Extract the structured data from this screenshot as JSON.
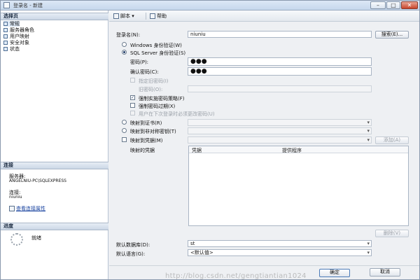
{
  "window": {
    "title": "登录名 - 新建",
    "controls": [
      "–",
      "□",
      "✕"
    ]
  },
  "left_panel": {
    "select_page_header": "选择页",
    "pages": [
      {
        "label": "常规"
      },
      {
        "label": "服务器角色"
      },
      {
        "label": "用户映射"
      },
      {
        "label": "安全对象"
      },
      {
        "label": "状态"
      }
    ],
    "connection_header": "连接",
    "server_label": "服务器:",
    "server_value": "ANGELNIU-PC\\SQLEXPRESS",
    "connection_label": "连接:",
    "connection_value": "niuniu",
    "view_connection_link": "查看连接属性",
    "progress_header": "进度",
    "progress_status": "就绪"
  },
  "toolbar": {
    "script_label": "脚本",
    "help_label": "帮助"
  },
  "form": {
    "login_name_label": "登录名(N):",
    "login_name_value": "niuniu",
    "search_button": "搜索(E)...",
    "windows_auth_label": "Windows 身份验证(W)",
    "sql_auth_label": "SQL Server 身份验证(S)",
    "password_label": "密码(P):",
    "password_value": "●●●",
    "confirm_password_label": "确认密码(C):",
    "confirm_password_value": "●●●",
    "specify_old_password_label": "指定旧密码(I)",
    "old_password_label": "旧密码(O):",
    "enforce_policy_label": "强制实施密码策略(F)",
    "enforce_expiration_label": "强制密码过期(X)",
    "must_change_label": "用户在下次登录时必须更改密码(U)",
    "map_certificate_label": "映射到证书(R)",
    "map_asymmetric_key_label": "映射到非对称密钥(T)",
    "map_credential_label": "映射到凭据(M)",
    "add_button": "添加(A)",
    "mapped_credentials_label": "映射的凭据",
    "credentials_columns": [
      "凭据",
      "提供程序"
    ],
    "remove_button": "删除(V)",
    "default_database_label": "默认数据库(D):",
    "default_database_value": "st",
    "default_language_label": "默认语言(G):",
    "default_language_value": "<默认值>"
  },
  "footer": {
    "watermark": "http://blog.csdn.net/gengtiantian1024",
    "ok_button": "确定",
    "cancel_button": "取消"
  },
  "colors": {
    "section_header": "#cbd7e6",
    "selected_nav": "#dbe7f5",
    "link": "#1a44a0"
  }
}
